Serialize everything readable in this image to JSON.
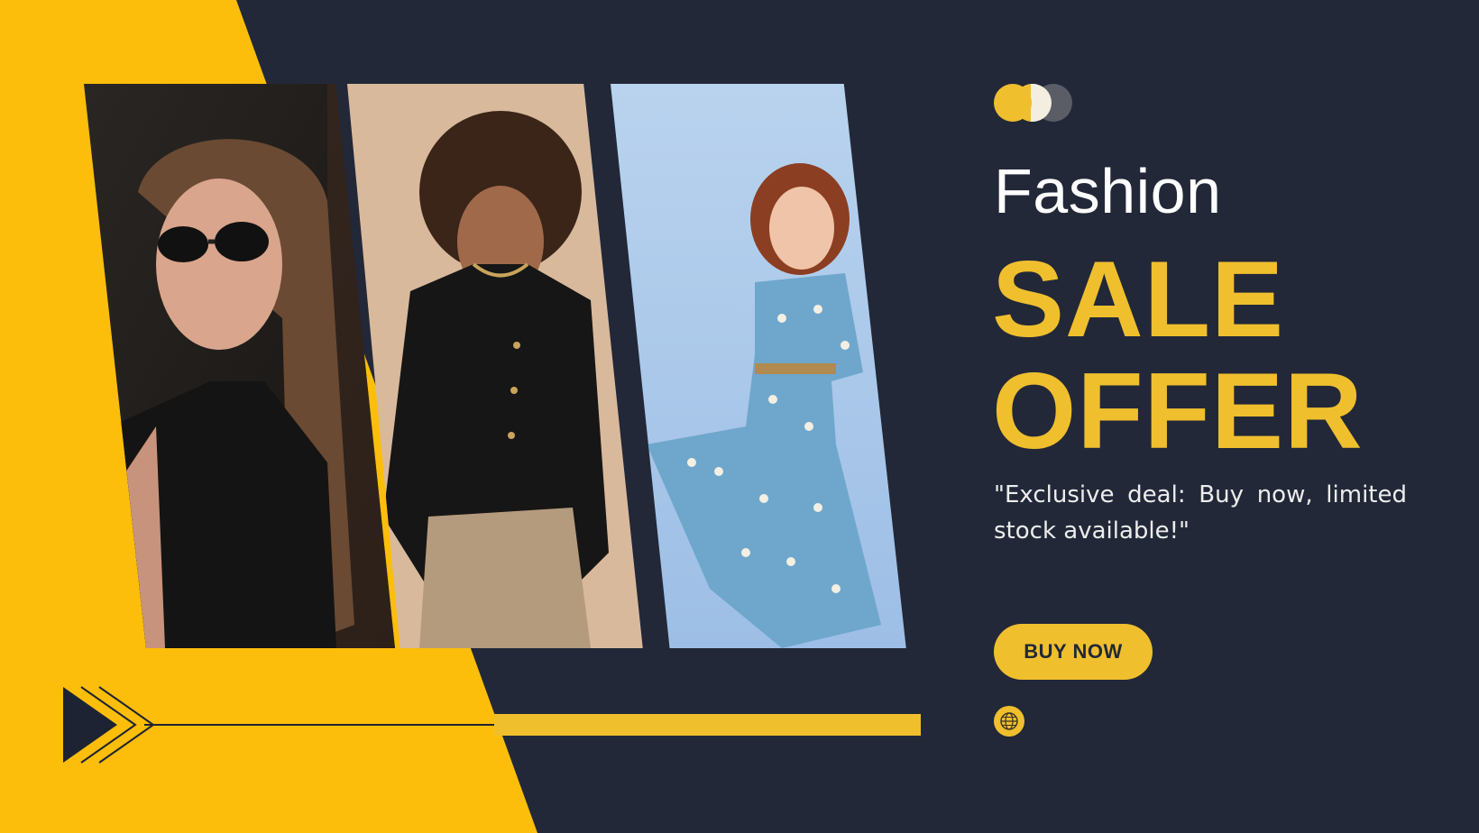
{
  "title": "Fashion",
  "headline": "SALE OFFER",
  "tagline": "\"Exclusive deal: Buy now, limited stock available!\"",
  "button_label": "BUY NOW",
  "icons": {
    "brand_dots": "three-circles-icon",
    "arrow": "triple-chevron-right-icon",
    "globe": "globe-icon"
  },
  "photos": [
    {
      "subject": "woman-in-sunglasses"
    },
    {
      "subject": "woman-in-black-blazer"
    },
    {
      "subject": "woman-in-floral-dress"
    }
  ],
  "colors": {
    "background": "#222838",
    "accent": "#F0BF2E",
    "yellow_panel": "#FCBE0A",
    "text_light": "#FFFFFF"
  }
}
